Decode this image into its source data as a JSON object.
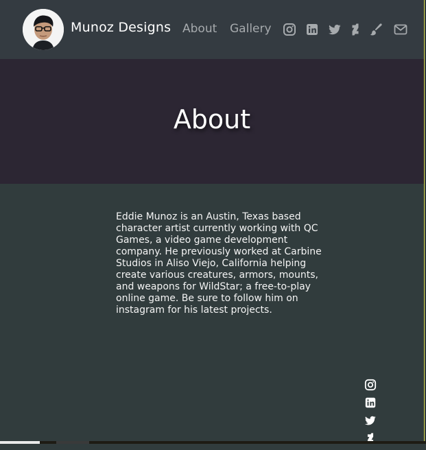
{
  "navbar": {
    "brand": "Munoz Designs",
    "links": [
      {
        "label": "About"
      },
      {
        "label": "Gallery"
      }
    ],
    "social_icons": [
      "instagram-icon",
      "linkedin-icon",
      "twitter-icon",
      "deviantart-icon",
      "paintbrush-icon",
      "envelope-icon"
    ]
  },
  "hero": {
    "title": "About"
  },
  "main": {
    "bio": "Eddie Munoz is an Austin, Texas based character artist currently working with QC Games, a video game development company. He previously worked at Carbine Studios in Aliso Viejo, California helping create various creatures, armors, mounts, and weapons for WildStar; a free-to-play online game. Be sure to follow him on instagram for his latest projects."
  },
  "side_social": [
    "instagram-icon",
    "linkedin-icon",
    "twitter-icon",
    "deviantart-icon"
  ],
  "colors": {
    "navbar_bg": "#343b41",
    "hero_bg": "#2c2633",
    "main_bg": "#313c3d",
    "nav_link": "#a6aaad",
    "text": "#ffffff"
  }
}
